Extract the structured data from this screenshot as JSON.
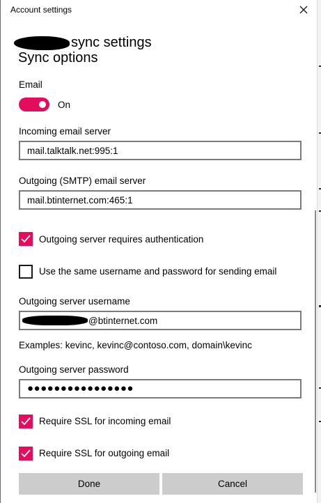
{
  "window": {
    "title": "Account settings"
  },
  "header": {
    "visible_suffix": "sync settings"
  },
  "section": {
    "title": "Sync options"
  },
  "email": {
    "label": "Email",
    "toggle_state": "On",
    "toggle_on": true
  },
  "incoming": {
    "label": "Incoming email server",
    "value": "mail.talktalk.net:995:1"
  },
  "outgoing": {
    "label": "Outgoing (SMTP) email server",
    "value": "mail.btinternet.com:465:1"
  },
  "checkboxes": {
    "requires_auth": {
      "label": "Outgoing server requires authentication",
      "checked": true
    },
    "same_credentials": {
      "label": "Use the same username and password for sending email",
      "checked": false
    },
    "ssl_incoming": {
      "label": "Require SSL for incoming email",
      "checked": true
    },
    "ssl_outgoing": {
      "label": "Require SSL for outgoing email",
      "checked": true
    }
  },
  "outgoing_username": {
    "label": "Outgoing server username",
    "value_suffix": "@btinternet.com",
    "hint": "Examples: kevinc, kevinc@contoso.com, domain\\kevinc"
  },
  "outgoing_password": {
    "label": "Outgoing server password",
    "masked_value": "●●●●●●●●●●●●●●●●"
  },
  "buttons": {
    "done": "Done",
    "cancel": "Cancel"
  },
  "colors": {
    "accent": "#e40c5c",
    "button_bg": "#cccccc",
    "field_border": "#7a7a7a"
  },
  "icons": {
    "close": "close-icon",
    "check": "checkmark-icon"
  }
}
